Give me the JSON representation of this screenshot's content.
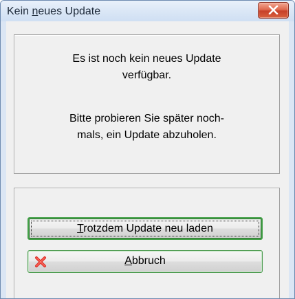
{
  "dialog": {
    "title_accel": "",
    "title_prefix": "Kein ",
    "title_u": "n",
    "title_rest": "eues Update",
    "close_icon": "close-icon"
  },
  "message": {
    "line1": "Es ist noch kein neues Update",
    "line2": "verfügbar.",
    "line3": "Bitte probieren Sie später noch-",
    "line4": "mals, ein Update abzuholen."
  },
  "buttons": {
    "reload": {
      "accel": "T",
      "rest": "rotzdem Update neu laden"
    },
    "cancel": {
      "accel": "A",
      "rest": "bbruch",
      "icon": "red-x-icon"
    }
  },
  "colors": {
    "titlebar": "#dbe7f6",
    "close_button": "#d4553a",
    "default_button_border": "#43a047",
    "cancel_icon": "#e0312a"
  }
}
